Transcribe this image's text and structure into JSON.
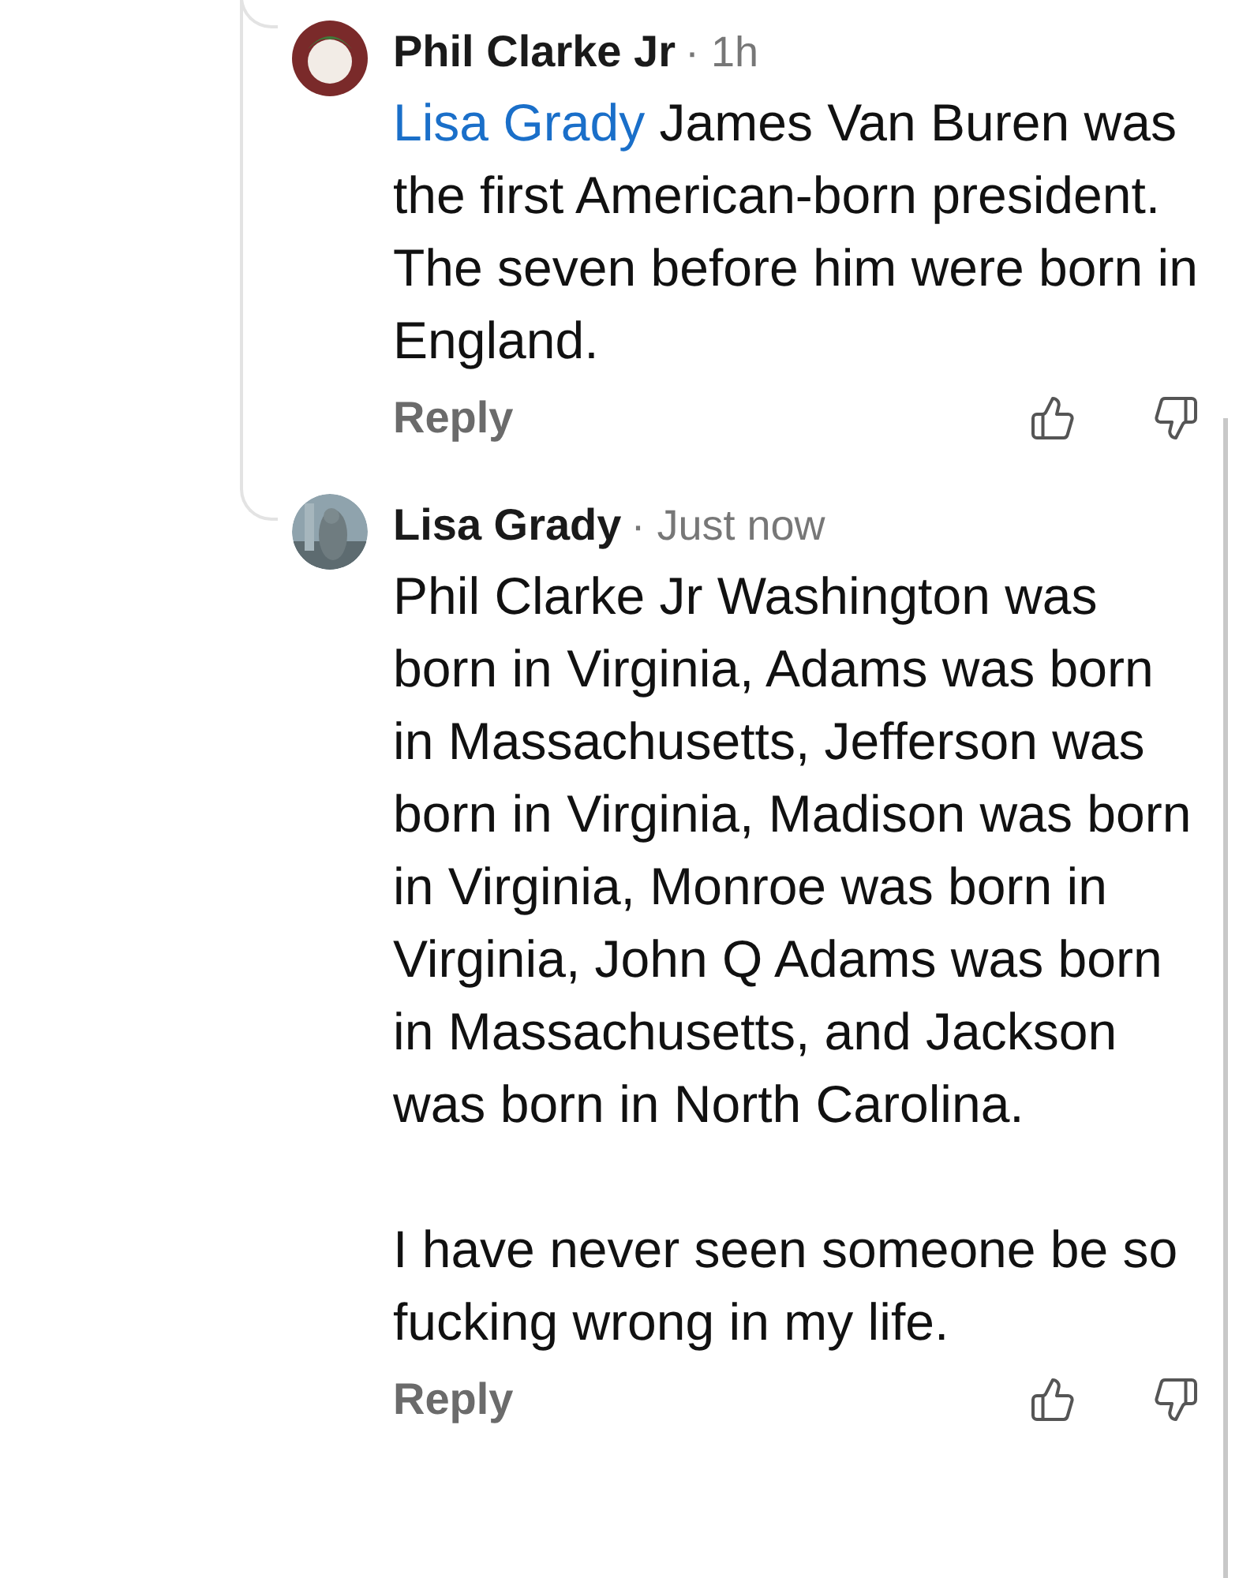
{
  "comments": [
    {
      "author": "Phil Clarke Jr",
      "time": "· 1h",
      "mention": "Lisa Grady",
      "paragraphs": [
        "James Van Buren was the first American-born president.  The seven before him were born in England."
      ],
      "reply": "Reply",
      "avatar": {
        "kind": "icon"
      }
    },
    {
      "author": "Lisa Grady",
      "time": "· Just now",
      "paragraphs": [
        "Phil Clarke Jr Washington was born in Virginia, Adams was born in Massachusetts, Jefferson was born in Virginia, Madison was born in Virginia, Monroe was born in Virginia, John Q Adams was born in Massachusetts, and Jackson was born in North Carolina.",
        "I have never seen someone be so fucking wrong in my life."
      ],
      "reply": "Reply"
    }
  ]
}
